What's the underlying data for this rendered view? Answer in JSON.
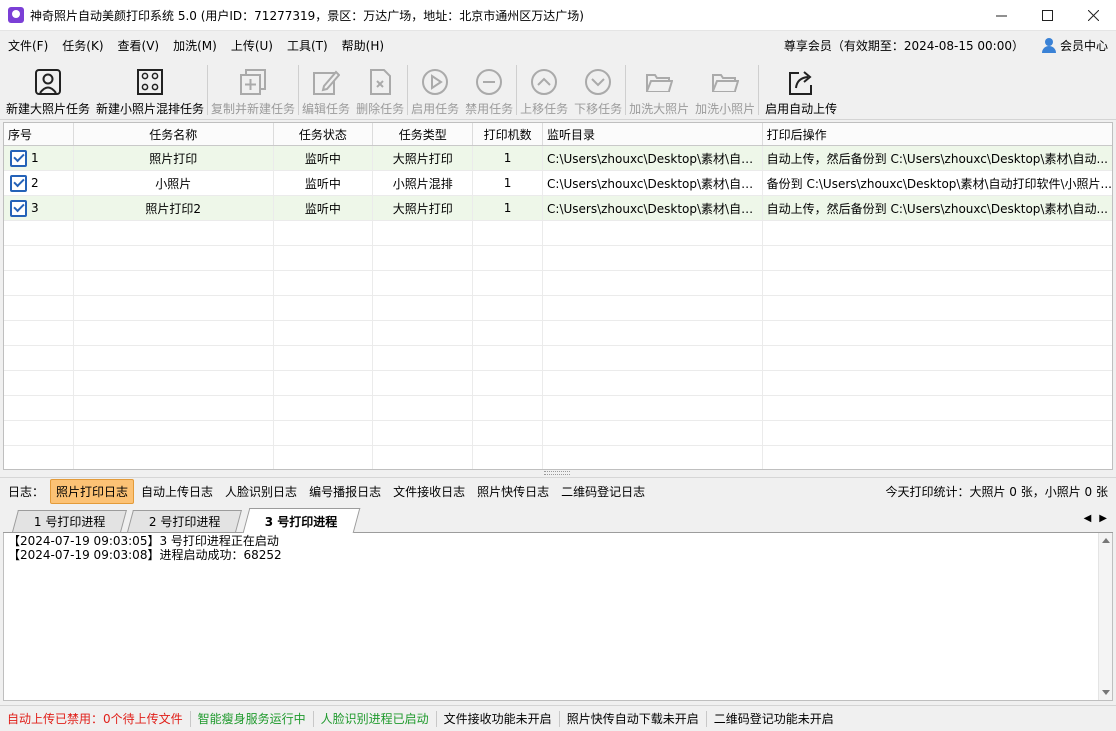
{
  "window": {
    "title": "神奇照片自动美颜打印系统 5.0 (用户ID：71277319，景区：万达广场，地址：北京市通州区万达广场)"
  },
  "menu": {
    "items": [
      "文件(F)",
      "任务(K)",
      "查看(V)",
      "加洗(M)",
      "上传(U)",
      "工具(T)",
      "帮助(H)"
    ],
    "vip": "尊享会员（有效期至：2024-08-15 00:00）",
    "member_center": "会员中心"
  },
  "toolbar": {
    "new_large": "新建大照片任务",
    "new_small": "新建小照片混排任务",
    "copy_new": "复制并新建任务",
    "edit": "编辑任务",
    "delete": "删除任务",
    "enable": "启用任务",
    "disable": "禁用任务",
    "move_up": "上移任务",
    "move_down": "下移任务",
    "add_large": "加洗大照片",
    "add_small": "加洗小照片",
    "auto_upload": "启用自动上传"
  },
  "table": {
    "columns": [
      "序号",
      "任务名称",
      "任务状态",
      "任务类型",
      "打印机数",
      "监听目录",
      "打印后操作"
    ],
    "rows": [
      {
        "no": "1",
        "name": "照片打印",
        "status": "监听中",
        "type": "大照片打印",
        "printers": "1",
        "dir": "C:\\Users\\zhouxc\\Desktop\\素材\\自动...",
        "after": "自动上传，然后备份到 C:\\Users\\zhouxc\\Desktop\\素材\\自动..."
      },
      {
        "no": "2",
        "name": "小照片",
        "status": "监听中",
        "type": "小照片混排",
        "printers": "1",
        "dir": "C:\\Users\\zhouxc\\Desktop\\素材\\自动...",
        "after": "备份到 C:\\Users\\zhouxc\\Desktop\\素材\\自动打印软件\\小照片..."
      },
      {
        "no": "3",
        "name": "照片打印2",
        "status": "监听中",
        "type": "大照片打印",
        "printers": "1",
        "dir": "C:\\Users\\zhouxc\\Desktop\\素材\\自动...",
        "after": "自动上传，然后备份到 C:\\Users\\zhouxc\\Desktop\\素材\\自动..."
      }
    ]
  },
  "logbar": {
    "label": "日志：",
    "tabs": [
      "照片打印日志",
      "自动上传日志",
      "人脸识别日志",
      "编号播报日志",
      "文件接收日志",
      "照片快传日志",
      "二维码登记日志"
    ],
    "stats": "今天打印统计：大照片 0 张，小照片 0 张"
  },
  "process_tabs": [
    "1 号打印进程",
    "2 号打印进程",
    "3 号打印进程"
  ],
  "log_lines": [
    "【2024-07-19 09:03:05】3 号打印进程正在启动",
    "【2024-07-19 09:03:08】进程启动成功：68252"
  ],
  "statusbar": {
    "items": [
      {
        "text": "自动上传已禁用：0个待上传文件",
        "color": "#e0201a"
      },
      {
        "text": "智能瘦身服务运行中",
        "color": "#1f9a2d"
      },
      {
        "text": "人脸识别进程已启动",
        "color": "#1f9a2d"
      },
      {
        "text": "文件接收功能未开启",
        "color": "#000000"
      },
      {
        "text": "照片快传自动下载未开启",
        "color": "#000000"
      },
      {
        "text": "二维码登记功能未开启",
        "color": "#000000"
      }
    ]
  }
}
